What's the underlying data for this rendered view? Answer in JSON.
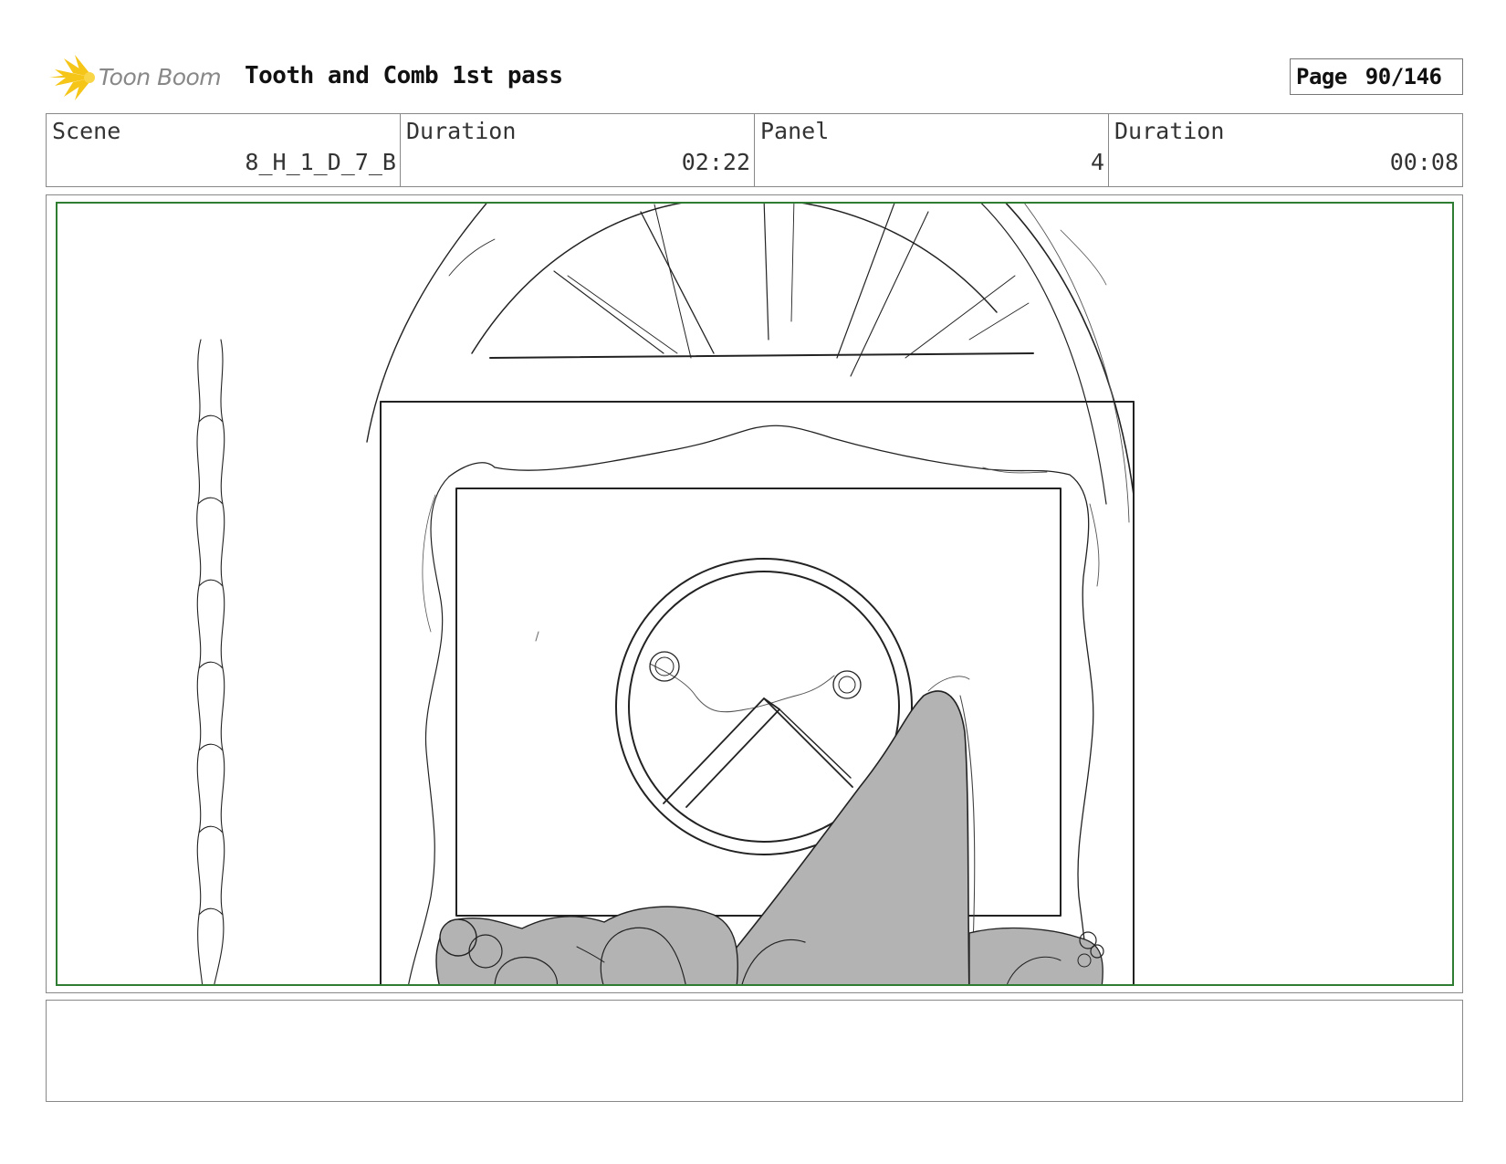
{
  "header": {
    "logo_text": "Toon Boom",
    "title": "Tooth and Comb 1st pass",
    "page_label": "Page",
    "page_value": "90/146"
  },
  "info": {
    "scene_label": "Scene",
    "scene_value": "8_H_1_D_7_B",
    "scene_duration_label": "Duration",
    "scene_duration_value": "02:22",
    "panel_label": "Panel",
    "panel_value": "4",
    "panel_duration_label": "Duration",
    "panel_duration_value": "00:08"
  },
  "notes": {
    "text": ""
  },
  "colors": {
    "safe_area": "#2e7d32",
    "logo_accent": "#f5c518",
    "sketch_fill": "#b3b3b3"
  }
}
